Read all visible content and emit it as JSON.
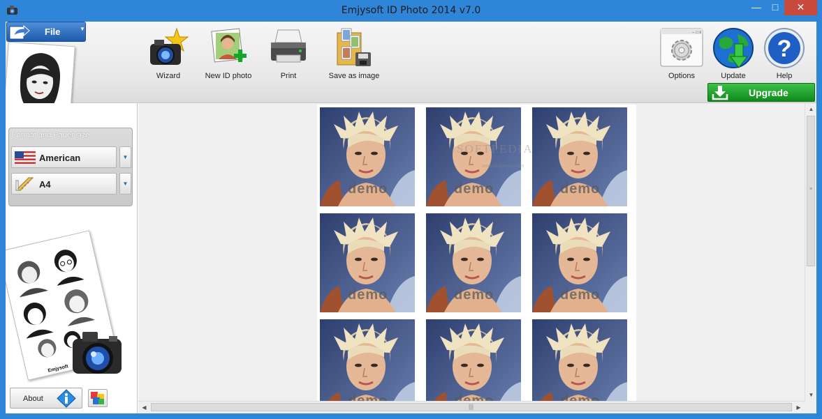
{
  "window": {
    "title": "Emjysoft ID Photo 2014 v7.0",
    "minimize": "—",
    "maximize": "□",
    "close": "✕"
  },
  "menu": {
    "file_label": "File",
    "file_caret": "▼"
  },
  "toolbar": {
    "wizard": "Wizard",
    "new_id_photo": "New ID photo",
    "print": "Print",
    "save_as_image": "Save as image",
    "options": "Options",
    "update": "Update",
    "help": "Help",
    "upgrade": "Upgrade"
  },
  "format_panel": {
    "title": "Format and Paper size",
    "format_value": "American",
    "paper_value": "A4",
    "dropdown_glyph": "▼"
  },
  "bottom_left": {
    "about": "About",
    "brand": "Emjysoft"
  },
  "preview": {
    "watermark": "SOFTPEDIA",
    "watermark_sub": "www.softpedia.com",
    "photo_label": "demo",
    "photos": [
      {
        "row": 1,
        "col": 1
      },
      {
        "row": 1,
        "col": 2
      },
      {
        "row": 1,
        "col": 3
      },
      {
        "row": 2,
        "col": 1
      },
      {
        "row": 2,
        "col": 2
      },
      {
        "row": 2,
        "col": 3
      },
      {
        "row": 3,
        "col": 1
      },
      {
        "row": 3,
        "col": 2
      },
      {
        "row": 3,
        "col": 3
      }
    ]
  },
  "scrollbars": {
    "up": "▲",
    "down": "▼",
    "left": "◀",
    "right": "▶",
    "grip_v": "≡",
    "grip_h": "|||"
  },
  "colors": {
    "title_bar": "#2f86d8",
    "close_button": "#c74a3c",
    "file_button": "#1e5aab",
    "upgrade_button": "#159a22"
  },
  "icons": {
    "app": "camera-icon",
    "wizard": "wizard-camera-star-icon",
    "new_id_photo": "photo-add-icon",
    "print": "printer-icon",
    "save_as_image": "folder-photos-icon",
    "options": "gear-icon",
    "update": "globe-download-icon",
    "help": "question-icon",
    "upgrade": "download-icon",
    "format": "us-flag-icon",
    "paper": "ruler-pencil-icon",
    "about": "info-icon",
    "colors": "color-squares-icon"
  }
}
